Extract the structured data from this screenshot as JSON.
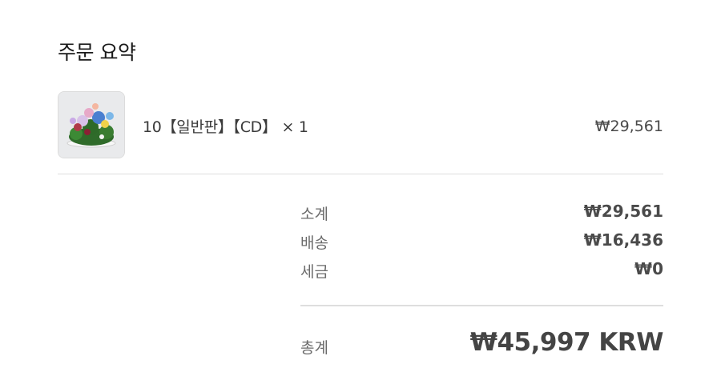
{
  "summary_title": "주문 요약",
  "items": [
    {
      "name": "10【일반판】【CD】",
      "quantity_text": "× 1",
      "price": "₩29,561"
    }
  ],
  "totals": {
    "subtotal_label": "소계",
    "subtotal_value": "₩29,561",
    "shipping_label": "배송",
    "shipping_value": "₩16,436",
    "tax_label": "세금",
    "tax_value": "₩0",
    "total_label": "총계",
    "total_value": "₩45,997 KRW"
  },
  "colors": {
    "text_primary": "#1a1a1a",
    "text_muted": "#6b6b6b",
    "divider": "#dedede"
  }
}
